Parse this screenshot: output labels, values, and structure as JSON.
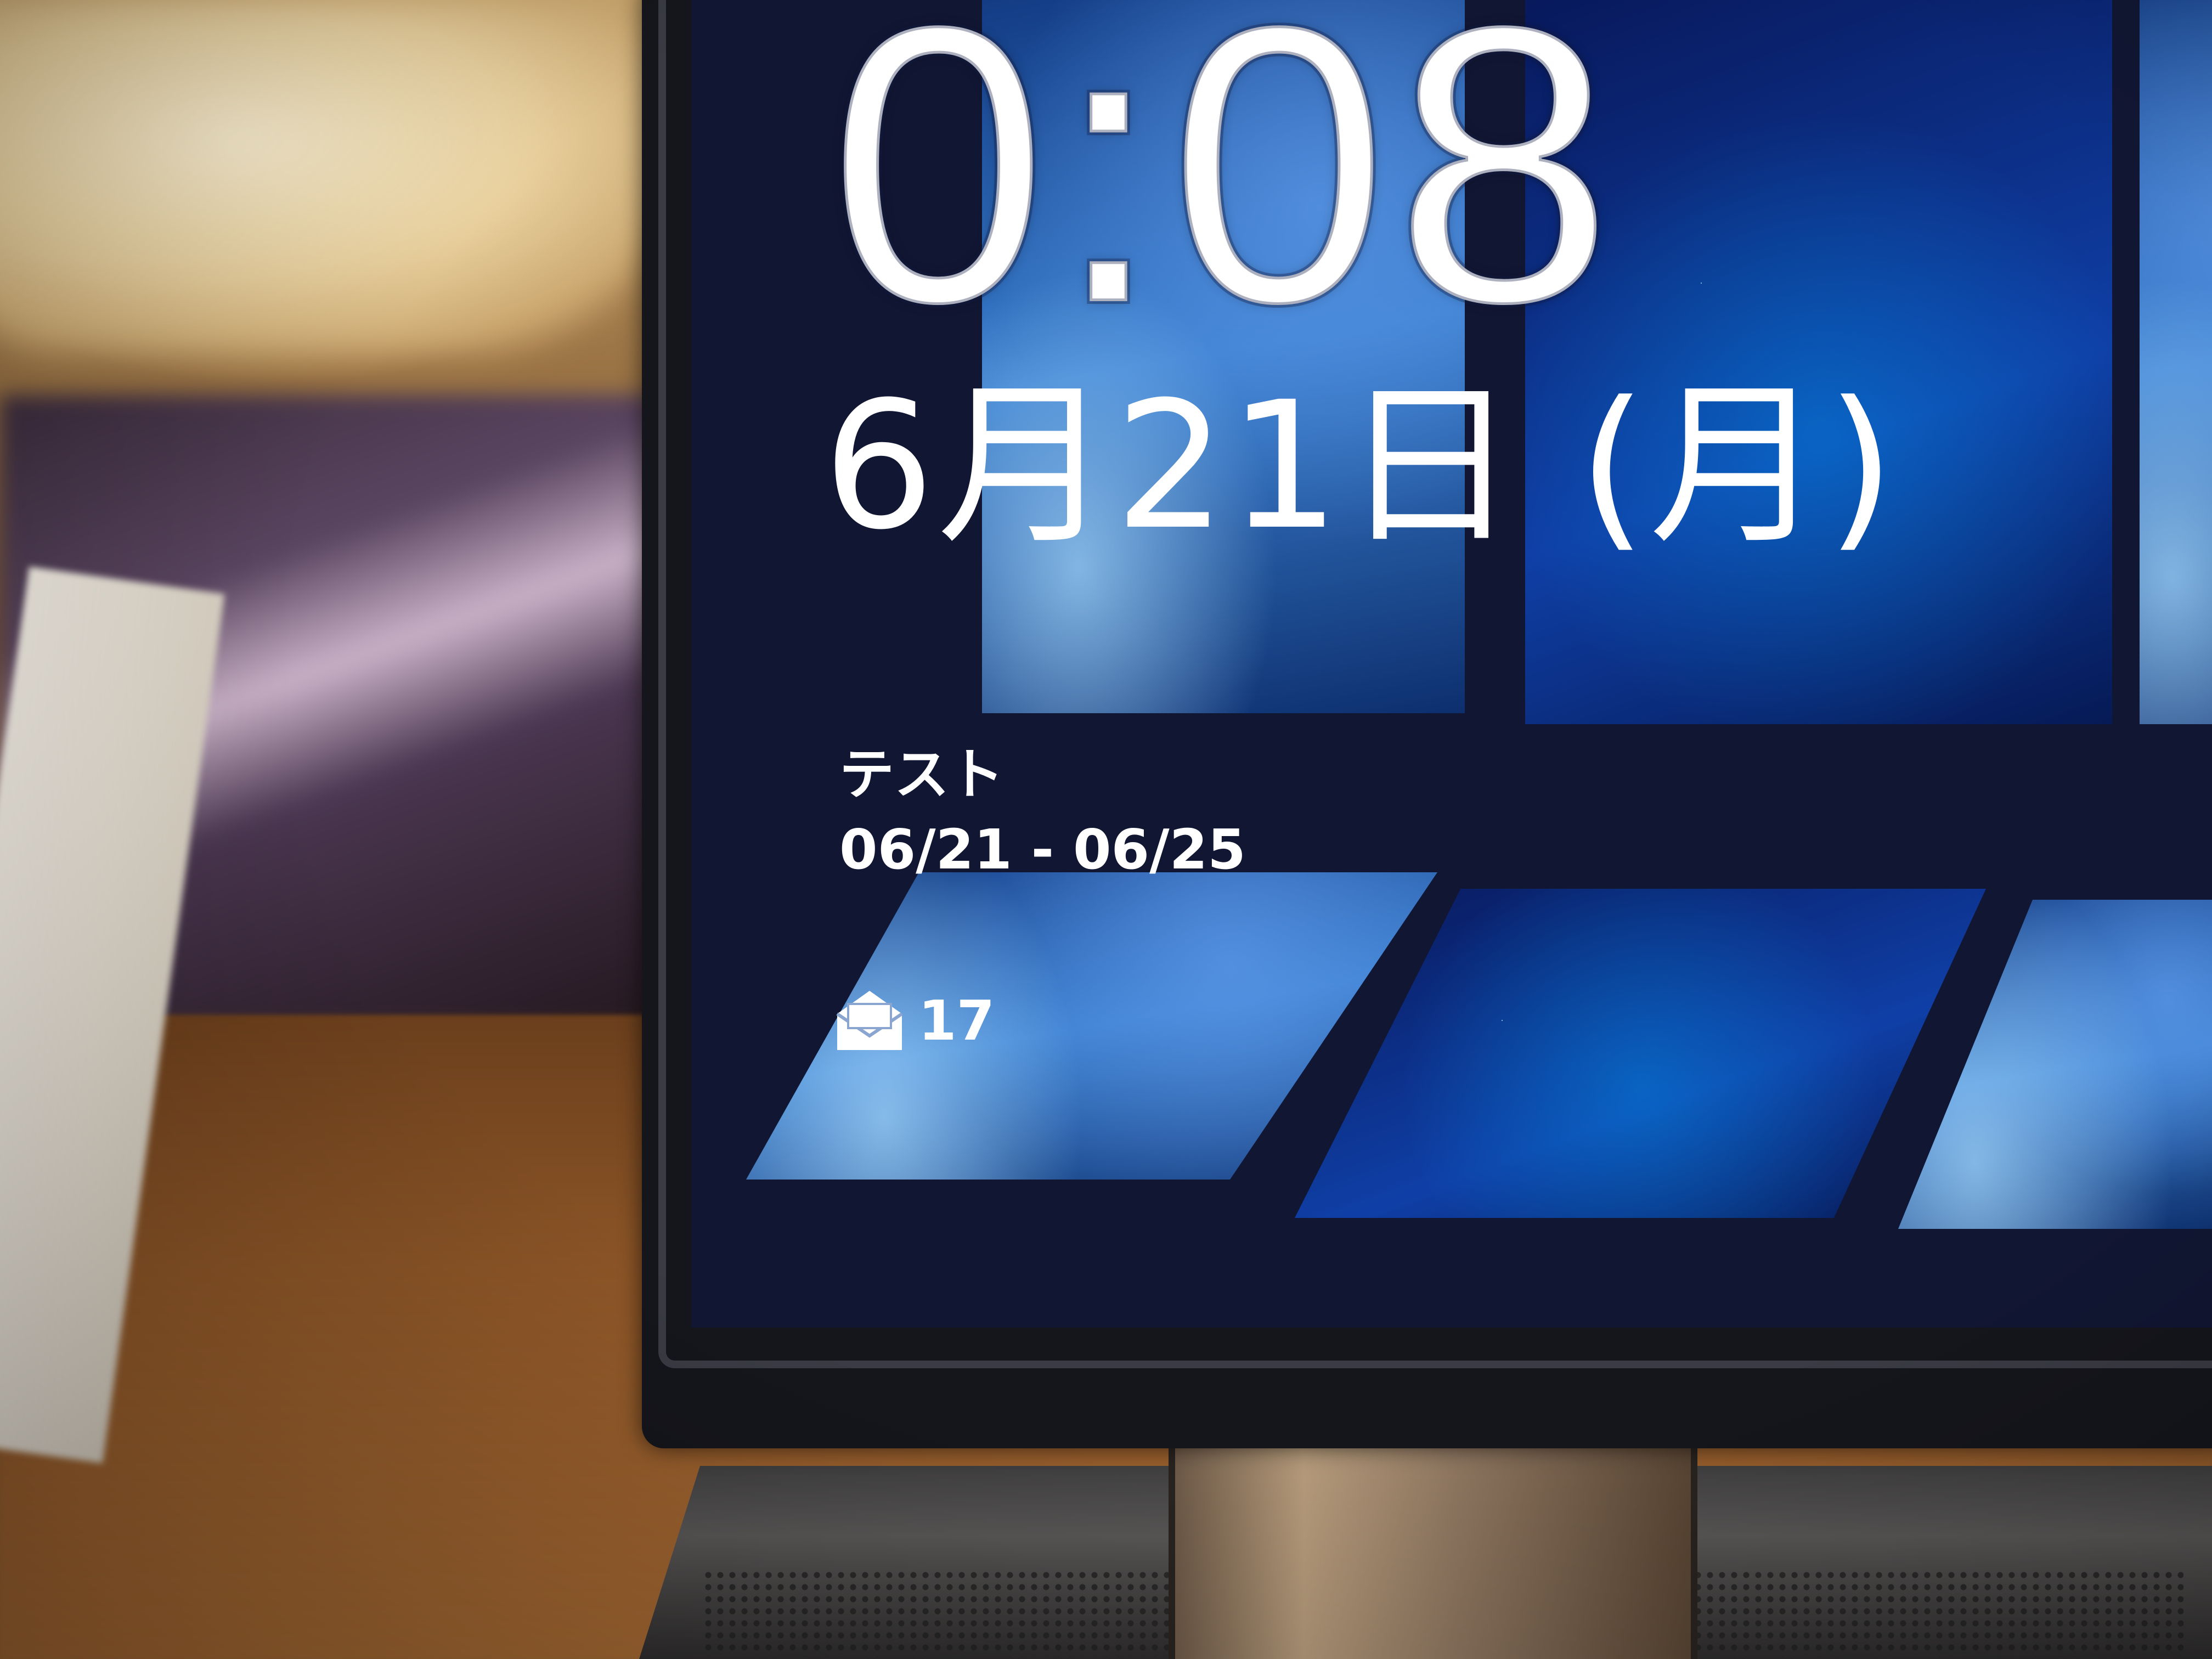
{
  "lock_screen": {
    "time": "0:08",
    "date": "6月21日 (月)",
    "event": {
      "title": "テスト",
      "range": "06/21 - 06/25"
    },
    "mail": {
      "icon": "mail-envelope-icon",
      "count": "17"
    }
  },
  "colors": {
    "text": "#ffffff",
    "screen_background": "#111633",
    "tile_blue": "#1d5fb8",
    "bezel": "#15161c"
  }
}
